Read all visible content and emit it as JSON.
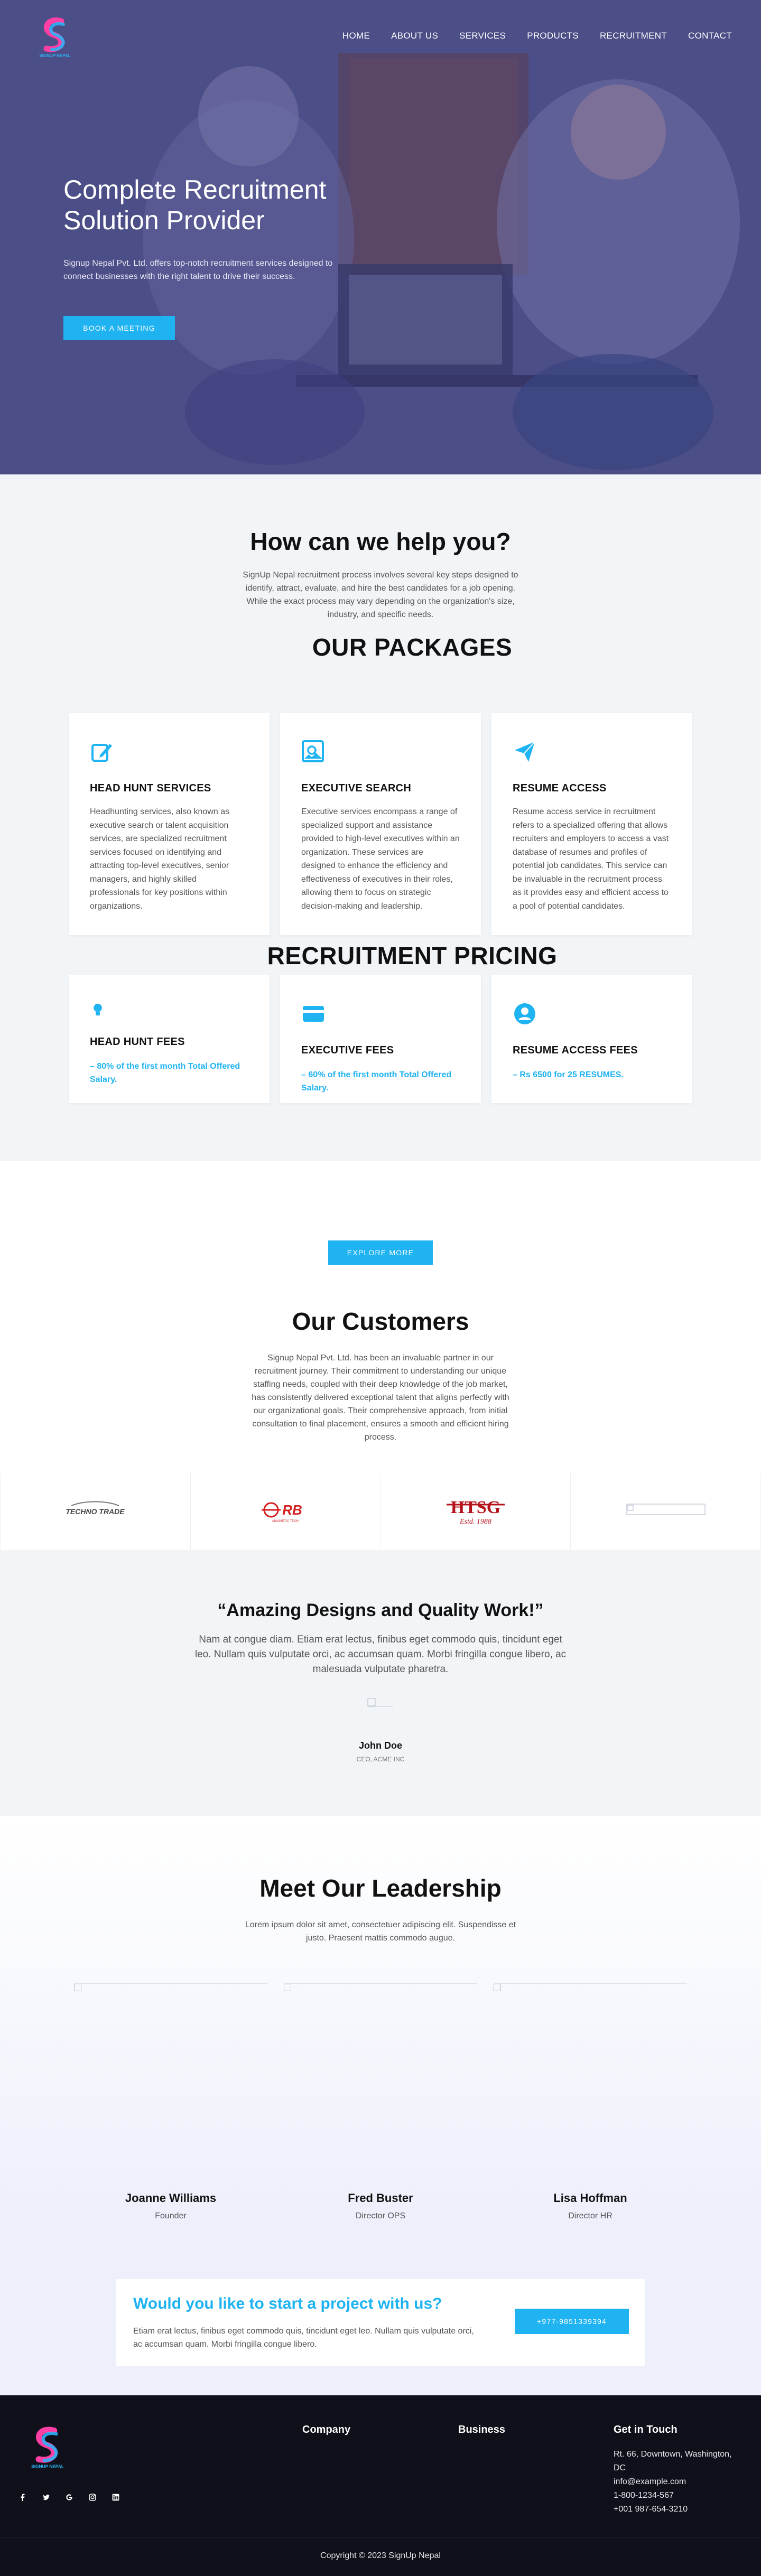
{
  "brand": {
    "logo_text": "SIGNUP NEPAL",
    "accent": "#1fb3f2",
    "dark": "#0f1019"
  },
  "nav": {
    "items": [
      "HOME",
      "ABOUT US",
      "SERVICES",
      "PRODUCTS",
      "RECRUITMENT",
      "CONTACT"
    ]
  },
  "hero": {
    "title": "Complete Recruitment Solution Provider",
    "subtitle": "Signup Nepal Pvt. Ltd. offers top-notch recruitment services designed to connect businesses with the right talent to drive their success.",
    "cta": "BOOK A MEETING"
  },
  "help": {
    "title": "How can we help you?",
    "text": "SignUp Nepal recruitment process involves several key steps designed to identify, attract, evaluate, and hire the best candidates for a job opening. While the exact process may vary depending on the organization's size, industry, and specific needs."
  },
  "packages": {
    "title": "OUR PACKAGES",
    "items": [
      {
        "icon": "edit-icon",
        "title": "HEAD HUNT SERVICES",
        "text": "Headhunting services, also known as executive search or talent acquisition services, are specialized recruitment services focused on identifying and attracting top-level executives, senior managers, and highly skilled professionals for key positions within organizations."
      },
      {
        "icon": "image-search-icon",
        "title": "EXECUTIVE SEARCH",
        "text": "Executive services encompass a range of specialized support and assistance provided to high-level executives within an organization. These services are designed to enhance the efficiency and effectiveness of executives in their roles, allowing them to focus on strategic decision-making and leadership."
      },
      {
        "icon": "paper-plane-icon",
        "title": "RESUME ACCESS",
        "text": "Resume access service in recruitment refers to a specialized offering that allows recruiters and employers to access a vast database of resumes and profiles of potential job candidates. This service can be invaluable in the recruitment process as it provides easy and efficient access to a pool of potential candidates."
      }
    ]
  },
  "pricing": {
    "title": "RECRUITMENT PRICING",
    "items": [
      {
        "icon": "lightbulb-icon",
        "title": "HEAD HUNT FEES",
        "fee": "– 80% of the first month Total Offered Salary."
      },
      {
        "icon": "credit-card-icon",
        "title": "EXECUTIVE FEES",
        "fee": "– 60% of the first month Total Offered Salary."
      },
      {
        "icon": "user-circle-icon",
        "title": "RESUME ACCESS FEES",
        "fee": "– Rs 6500 for 25 RESUMES."
      }
    ]
  },
  "explore": {
    "cta": "EXPLORE MORE"
  },
  "customers": {
    "title": "Our Customers",
    "text": "Signup Nepal Pvt. Ltd. has been an invaluable partner in our recruitment journey. Their commitment to understanding our unique staffing needs, coupled with their deep knowledge of the job market, has consistently delivered exceptional talent that aligns perfectly with our organizational goals. Their comprehensive approach, from initial consultation to final placement, ensures a smooth and efficient hiring process.",
    "logos": [
      "TECHNO TRADE",
      "RB",
      "HTSG",
      ""
    ],
    "logo_sub": [
      "",
      "MAGNETIC TECH",
      "Estd. 1988",
      ""
    ]
  },
  "testimonial": {
    "title": "“Amazing Designs and Quality Work!”",
    "quote": "Nam at congue diam. Etiam erat lectus, finibus eget commodo quis, tincidunt eget leo. Nullam quis vulputate orci, ac accumsan quam. Morbi fringilla congue libero, ac malesuada vulputate pharetra.",
    "name": "John Doe",
    "role": "CEO, ACME INC"
  },
  "leadership": {
    "title": "Meet Our Leadership",
    "text": "Lorem ipsum dolor sit amet, consectetuer adipiscing elit. Suspendisse et justo. Praesent mattis commodo augue.",
    "members": [
      {
        "name": "Joanne Williams",
        "role": "Founder"
      },
      {
        "name": "Fred Buster",
        "role": "Director OPS"
      },
      {
        "name": "Lisa Hoffman",
        "role": "Director HR"
      }
    ]
  },
  "cta": {
    "title": "Would you like to start a project with us?",
    "text": "Etiam erat lectus, finibus eget commodo quis, tincidunt eget leo. Nullam quis vulputate orci, ac accumsan quam. Morbi fringilla congue libero.",
    "button": "+977-9851339394"
  },
  "footer": {
    "company": "Company",
    "business": "Business",
    "get_in_touch": "Get in Touch",
    "address_1": "Rt. 66, Downtown, Washington,",
    "address_2": "DC",
    "email": "info@example.com",
    "phone_1": "1-800-1234-567",
    "phone_2": "+001 987-654-3210",
    "copyright": "Copyright © 2023 SignUp Nepal",
    "socials": [
      "facebook-icon",
      "twitter-icon",
      "google-icon",
      "instagram-icon",
      "linkedin-icon"
    ]
  }
}
